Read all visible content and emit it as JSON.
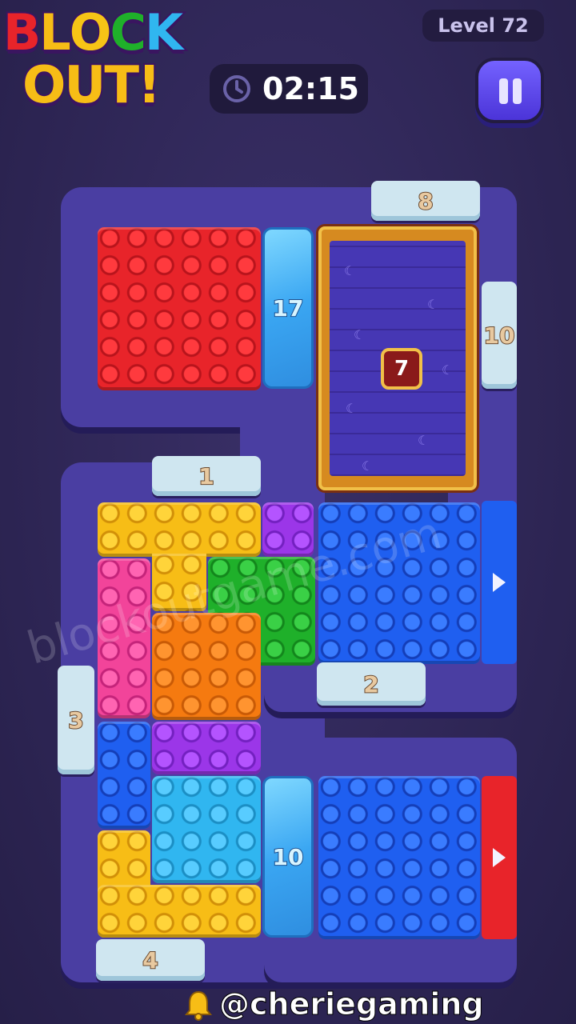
{
  "header": {
    "logo_line1": [
      "B",
      "L",
      "O",
      "C",
      "K"
    ],
    "logo_line2": [
      "O",
      "U",
      "T",
      "!"
    ],
    "level_label": "Level 72",
    "timer": "02:15",
    "pause_icon": "pause-icon",
    "clock_icon": "clock-icon"
  },
  "gates": {
    "top_right": "8",
    "right_upper": "10",
    "middle_left": "1",
    "middle_center": "2",
    "left_side": "3",
    "bottom_left": "4"
  },
  "ice_blocks": {
    "upper": "17",
    "lower": "10"
  },
  "crate": {
    "count": "7"
  },
  "exits": {
    "blue_exit": "arrow-right-icon",
    "red_exit": "arrow-right-icon"
  },
  "colors": {
    "red": "#e8242a",
    "blue": "#1f5ff0",
    "yellow": "#f7bd16",
    "pink": "#f2449a",
    "purple": "#9b36e8",
    "green": "#1fb02a",
    "orange": "#f57a10",
    "cyan": "#30b6f0",
    "board": "#4a3ea2"
  },
  "watermark": "blockoutgame.com",
  "footer": {
    "handle": "@cheriegaming",
    "bell_icon": "bell-icon"
  }
}
